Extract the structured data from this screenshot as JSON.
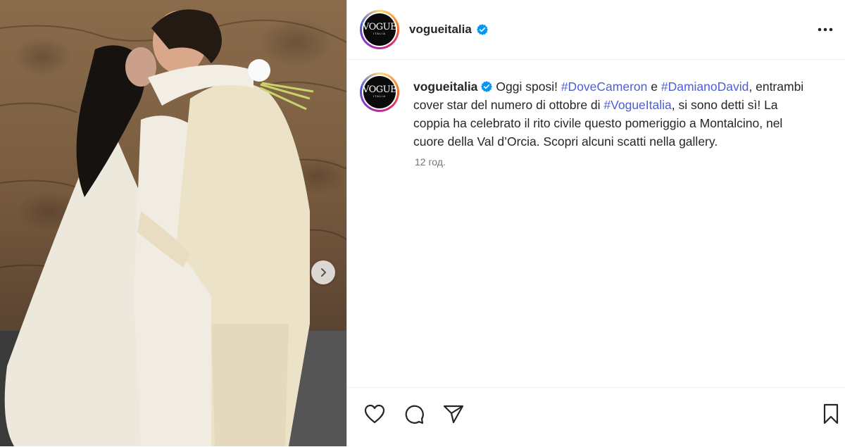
{
  "post": {
    "username": "vogueitalia",
    "avatar_logo": "VOGUE",
    "avatar_logo_sub": "ITALIA",
    "verified": true
  },
  "caption": {
    "username": "vogueitalia",
    "t1": "Oggi sposi! ",
    "tag1": "#DoveCameron",
    "t2": " e ",
    "tag2": "#DamianoDavid",
    "t3": ", entrambi cover star del numero di ottobre di ",
    "tag3": "#VogueItalia",
    "t4": ", si sono detti sì! La coppia ha celebrato il rito civile questo pomeriggio a Montalcino, nel cuore della Val d’Orcia. Scopri alcuni scatti nella gallery.",
    "timestamp": "12 год."
  },
  "icons": {
    "verified": "verified-badge-icon",
    "more": "more-options-icon",
    "carousel": "chevron-right-icon",
    "like": "heart-icon",
    "comment": "comment-icon",
    "share": "send-icon",
    "save": "bookmark-icon"
  },
  "colors": {
    "hashtag": "#4c5fd5",
    "verified": "#0095f6",
    "text": "#262626",
    "muted": "#737373"
  }
}
